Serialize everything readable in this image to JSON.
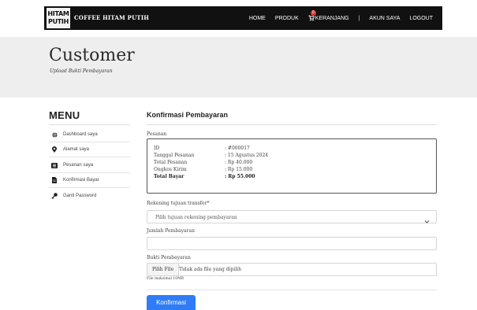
{
  "navbar": {
    "logo_text": "HITAM PUTIH",
    "brand": "COFFEE HITAM PUTIH",
    "links": {
      "home": "HOME",
      "produk": "PRODUK",
      "keranjang": "KERANJANG",
      "separator": "|",
      "akun": "AKUN SAYA",
      "logout": "LOGOUT"
    },
    "cart_count": "0",
    "accent": "#111111"
  },
  "header": {
    "title": "Customer",
    "subtitle": "Upload Bukti Pembayaran"
  },
  "sidebar": {
    "title": "MENU",
    "items": [
      {
        "label": "Dashboard saya",
        "icon": "globe-icon"
      },
      {
        "label": "Alamat saya",
        "icon": "map-pin-icon"
      },
      {
        "label": "Pesanan saya",
        "icon": "list-icon"
      },
      {
        "label": "Konfirmasi Bayar",
        "icon": "file-icon"
      },
      {
        "label": "Ganti Password",
        "icon": "key-icon"
      }
    ]
  },
  "main": {
    "title": "Konfirmasi Pembayaran",
    "pesanan_label": "Pesanan",
    "order": {
      "id_label": "ID",
      "id_value": ": #000017",
      "date_label": "Tanggal Pesanan",
      "date_value": ": 15 Agustus 2024",
      "total_label": "Total Pesanan",
      "total_value": ": Rp 40.000",
      "shipping_label": "Ongkos Kirim",
      "shipping_value": ": Rp 15.000",
      "pay_label": "Total Bayar",
      "pay_value": ": Rp 55.000"
    },
    "rekening_label": "Rekening tujuan transfer*",
    "rekening_placeholder": "Pilih tujuan rekening pembayaran",
    "jumlah_label": "Jumlah Pembayaran",
    "bukti_label": "Bukti Pembayaran",
    "file_button": "Pilih File",
    "file_text": "Tidak ada file yang dipilih",
    "file_hint": "File maksimal 10MB",
    "submit_label": "Konfirmasi",
    "submit_color": "#2f7cf6"
  }
}
